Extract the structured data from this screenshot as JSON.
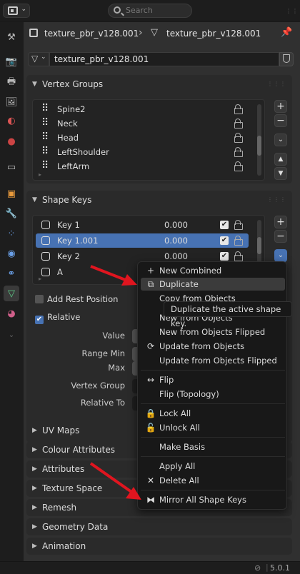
{
  "header": {
    "search_placeholder": "Search"
  },
  "breadcrumb": {
    "object_name": "texture_pbr_v128.001",
    "mesh_name": "texture_pbr_v128.001"
  },
  "datablock": {
    "name": "texture_pbr_v128.001"
  },
  "vertex_groups": {
    "title": "Vertex Groups",
    "items": [
      {
        "label": "Spine2"
      },
      {
        "label": "Neck"
      },
      {
        "label": "Head"
      },
      {
        "label": "LeftShoulder"
      },
      {
        "label": "LeftArm"
      }
    ]
  },
  "shape_keys": {
    "title": "Shape Keys",
    "items": [
      {
        "label": "Key 1",
        "value": "0.000",
        "selected": false
      },
      {
        "label": "Key 1.001",
        "value": "0.000",
        "selected": true
      },
      {
        "label": "Key 2",
        "value": "0.000",
        "selected": false
      },
      {
        "label": "A",
        "value": "",
        "selected": false
      }
    ],
    "add_rest_position": "Add Rest Position",
    "relative": "Relative",
    "props": {
      "value": "Value",
      "range_min": "Range Min",
      "max": "Max",
      "vertex_group": "Vertex Group",
      "relative_to": "Relative To"
    }
  },
  "collapsed_panels": [
    "UV Maps",
    "Colour Attributes",
    "Attributes",
    "Texture Space",
    "Remesh",
    "Geometry Data",
    "Animation"
  ],
  "context_menu": {
    "items": [
      {
        "label": "New Combined",
        "icon": "plus-icon"
      },
      {
        "label": "Duplicate",
        "icon": "duplicate-icon",
        "highlighted": true
      },
      {
        "label": "Copy from Objects",
        "icon": ""
      },
      {
        "label": "New from Objects",
        "icon": ""
      },
      {
        "label": "New from Objects Flipped",
        "icon": ""
      },
      {
        "label": "Update from Objects",
        "icon": "refresh-icon"
      },
      {
        "label": "Update from Objects Flipped",
        "icon": ""
      },
      {
        "label": "Flip",
        "icon": "flip-icon"
      },
      {
        "label": "Flip (Topology)",
        "icon": ""
      },
      {
        "label": "Lock All",
        "icon": "lock-icon"
      },
      {
        "label": "Unlock All",
        "icon": "unlock-icon"
      },
      {
        "label": "Make Basis",
        "icon": ""
      },
      {
        "label": "Apply All",
        "icon": ""
      },
      {
        "label": "Delete All",
        "icon": "close-icon"
      },
      {
        "label": "Mirror All Shape Keys",
        "icon": "mirror-icon"
      }
    ]
  },
  "tooltip": "Duplicate the active shape key.",
  "status": {
    "version": "5.0.1"
  },
  "colors": {
    "accent": "#4772b3",
    "annotation": "#e0151f"
  }
}
